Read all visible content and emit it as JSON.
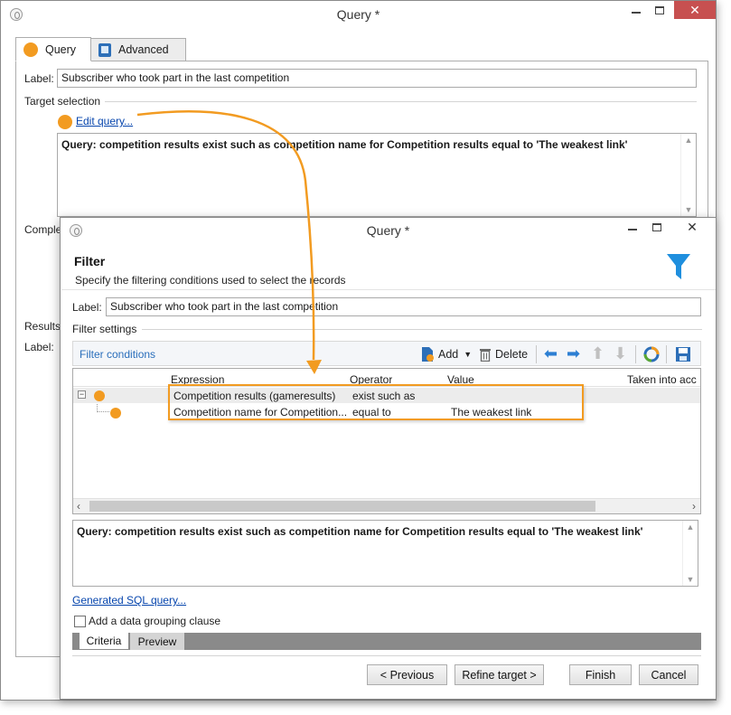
{
  "back_window": {
    "title": "Query *",
    "tabs": [
      {
        "label": "Query"
      },
      {
        "label": "Advanced"
      }
    ],
    "label_caption": "Label:",
    "label_value": "Subscriber who took part in the last competition",
    "target_selection_title": "Target selection",
    "edit_query_link": "Edit query...",
    "query_text": "Query: competition results exist such as competition name for Competition results equal to 'The weakest link'",
    "complement_title_partial": "Comple",
    "results_title_partial": "Results",
    "results_label_caption": "Label:"
  },
  "front_window": {
    "title": "Query *",
    "header_title": "Filter",
    "header_subtitle": "Specify the filtering conditions used to select the records",
    "label_caption": "Label:",
    "label_value": "Subscriber who took part in the last competition",
    "filter_settings_title": "Filter settings",
    "filter_conditions_label": "Filter conditions",
    "toolbar": {
      "add_label": "Add",
      "delete_label": "Delete"
    },
    "grid": {
      "columns": [
        "Expression",
        "Operator",
        "Value",
        "Taken into acc"
      ],
      "rows": [
        {
          "expression": "Competition results (gameresults)",
          "operator": "exist such as",
          "value": ""
        },
        {
          "expression": "Competition name for Competition...",
          "operator": "equal to",
          "value": "The weakest link"
        }
      ]
    },
    "query_text": "Query: competition results exist such as competition name for Competition results equal to 'The weakest link'",
    "generated_sql_link": "Generated SQL query...",
    "grouping_checkbox_label": "Add a data grouping clause",
    "grouping_checked": false,
    "bottom_tabs": [
      {
        "label": "Criteria"
      },
      {
        "label": "Preview"
      }
    ],
    "buttons": {
      "previous": "< Previous",
      "refine": "Refine target >",
      "finish": "Finish",
      "cancel": "Cancel"
    }
  },
  "colors": {
    "accent_orange": "#f29b21",
    "link_blue": "#0645ad",
    "close_red": "#c75050",
    "funnel_blue": "#1f8fde"
  }
}
